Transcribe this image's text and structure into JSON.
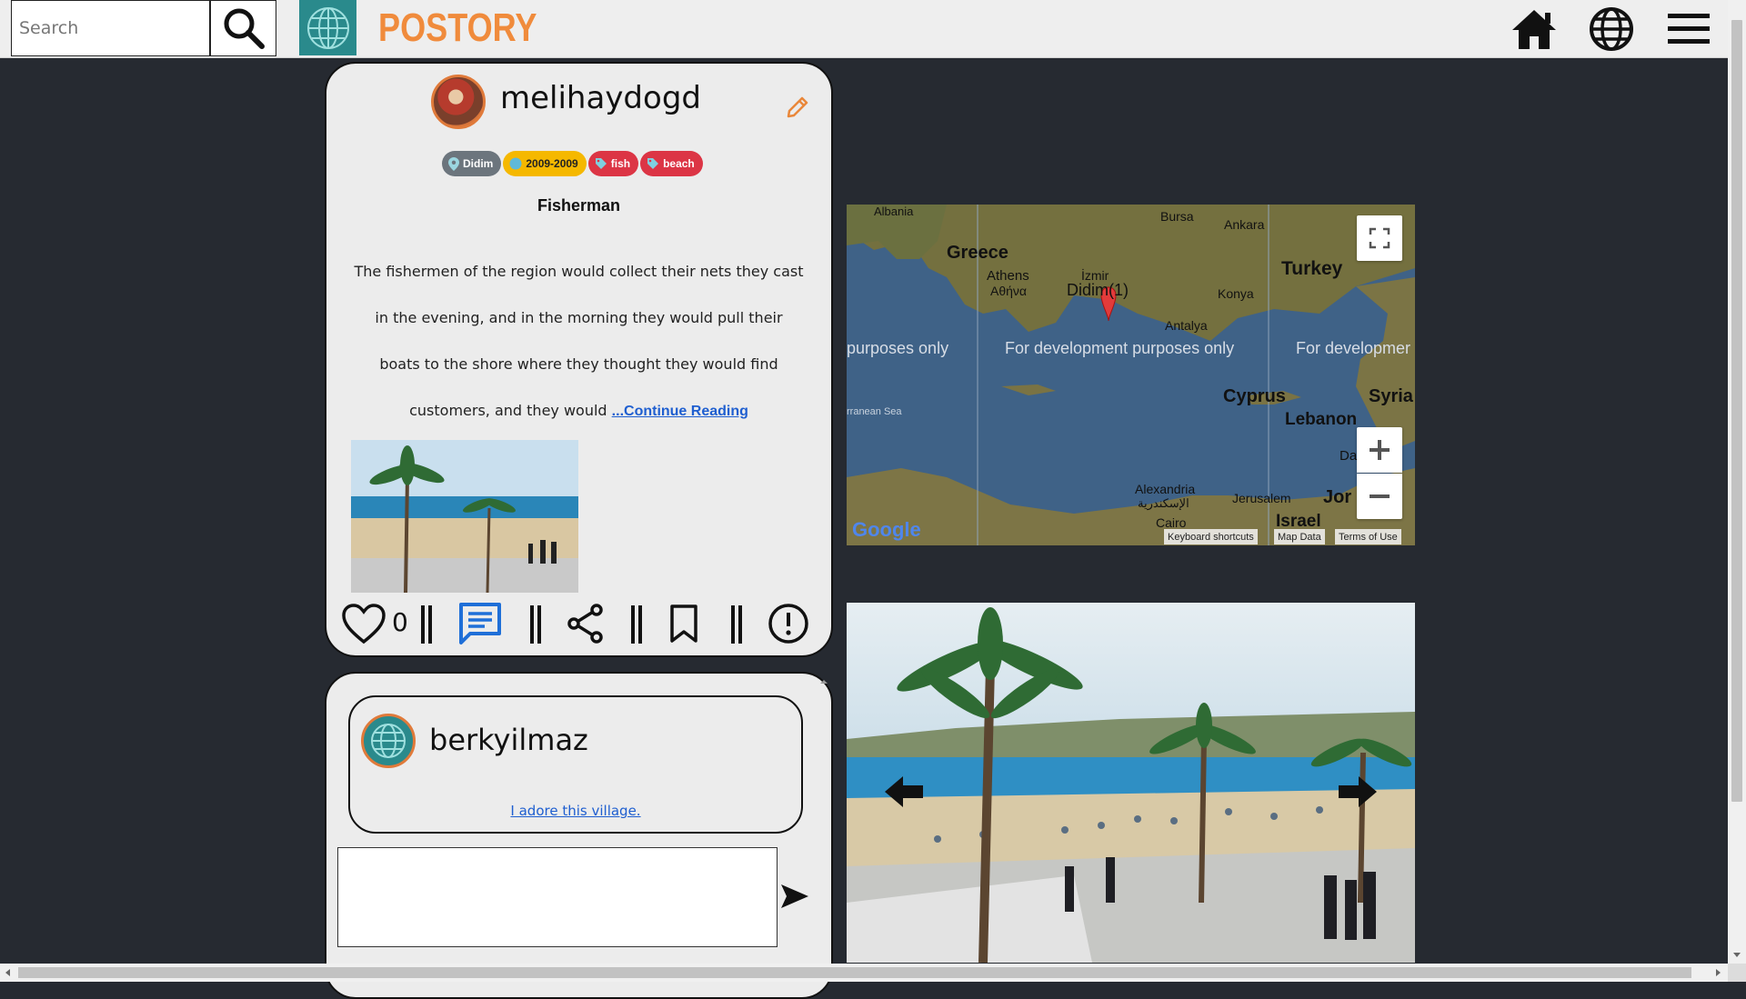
{
  "header": {
    "search_placeholder": "Search",
    "brand": "POSTORY",
    "icons": [
      "search-icon",
      "home-icon",
      "globe-icon",
      "menu-icon"
    ]
  },
  "post": {
    "username": "melihaydogd",
    "tags": [
      {
        "label": "Didim",
        "icon": "location-icon",
        "color": "#6c757d"
      },
      {
        "label": "2009-2009",
        "icon": "clock-icon",
        "color": "#f5b800"
      },
      {
        "label": "fish",
        "icon": "tag-icon",
        "color": "#dc3545"
      },
      {
        "label": "beach",
        "icon": "tag-icon",
        "color": "#dc3545"
      }
    ],
    "title": "Fisherman",
    "body": "The fishermen of the region would collect their nets they cast in the evening, and in the morning they would pull their boats to the shore where they thought they would find customers, and they would ",
    "continue_label": "...Continue Reading",
    "like_count": "0"
  },
  "comments": [
    {
      "username": "berkyilmaz",
      "text": "I adore this village."
    }
  ],
  "map": {
    "labels": {
      "albania": "Albania",
      "greece": "Greece",
      "athens": "Athens",
      "athens_local": "Αθήνα",
      "bursa": "Bursa",
      "ankara": "Ankara",
      "turkey": "Turkey",
      "izmir": "İzmir",
      "marker": "Didim(1)",
      "konya": "Konya",
      "antalya": "Antalya",
      "cyprus": "Cyprus",
      "syria": "Syria",
      "lebanon": "Lebanon",
      "alexandria": "Alexandria",
      "alexandria_local": "الإسكندرية",
      "jerusalem": "Jerusalem",
      "cairo": "Cairo",
      "israel": "Israel",
      "jordan": "Jor",
      "da": "Da",
      "med_sea": "rranean Sea"
    },
    "watermark_left": "purposes only",
    "watermark_mid": "For development purposes only",
    "watermark_right": "For developmer",
    "google": "Google",
    "footer_shortcuts": "Keyboard shortcuts",
    "footer_data": "Map Data",
    "footer_terms": "Terms of Use"
  },
  "colors": {
    "brand": "#f08b3c",
    "teal": "#2a8a8c",
    "link": "#1f5fd0",
    "comment_icon": "#1f6fd8"
  }
}
